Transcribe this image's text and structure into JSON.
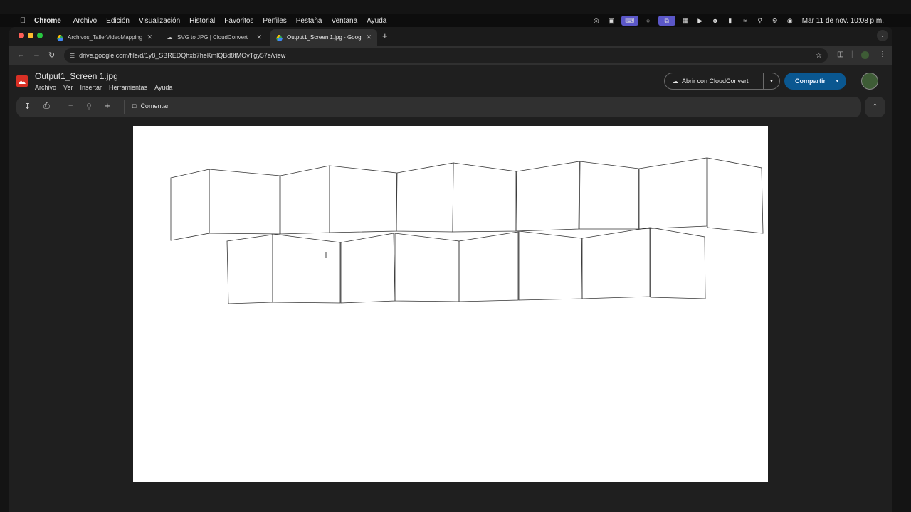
{
  "menubar": {
    "items": [
      "Chrome",
      "Archivo",
      "Edición",
      "Visualización",
      "Historial",
      "Favoritos",
      "Perfiles",
      "Pestaña",
      "Ventana",
      "Ayuda"
    ],
    "clock": "Mar 11 de nov.  10:08 p.m."
  },
  "browser": {
    "tabs": [
      {
        "title": "Archivos_TallerVideoMapping",
        "icon": "google-drive-icon",
        "active": false
      },
      {
        "title": "SVG to JPG | CloudConvert",
        "icon": "cloudconvert-icon",
        "active": false
      },
      {
        "title": "Output1_Screen 1.jpg - Google",
        "icon": "google-drive-icon",
        "active": true
      }
    ],
    "url": "drive.google.com/file/d/1y8_SBREDQhxb7heKmlQBd8fMOvTgy57e/view"
  },
  "viewer": {
    "file_name": "Output1_Screen 1.jpg",
    "menus": [
      "Archivo",
      "Ver",
      "Insertar",
      "Herramientas",
      "Ayuda"
    ],
    "open_with_label": "Abrir con CloudConvert",
    "share_label": "Compartir",
    "comment_label": "Comentar"
  },
  "colors": {
    "share_button": "#0a5790",
    "file_icon": "#d93025",
    "window_bg": "#1f1f1f"
  }
}
